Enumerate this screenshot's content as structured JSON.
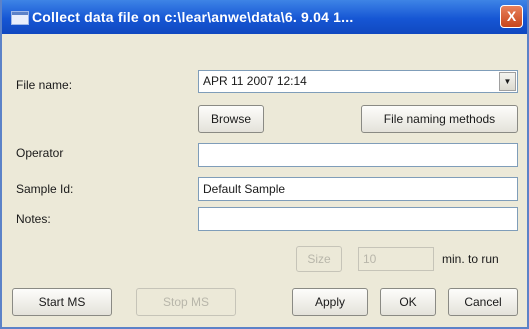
{
  "window": {
    "title": "Collect data file on c:\\lear\\anwe\\data\\6. 9.04 1...",
    "close_label": "X"
  },
  "form": {
    "file_name_label": "File name:",
    "file_name_value": "APR 11 2007 12:14",
    "file_name_arrow": "▼",
    "browse_label": "Browse",
    "naming_methods_label": "File naming methods",
    "operator_label": "Operator",
    "operator_value": "",
    "sample_id_label": "Sample Id:",
    "sample_id_value": "Default Sample",
    "notes_label": "Notes:",
    "notes_value": ""
  },
  "run": {
    "size_label": "Size",
    "minutes_value": "10",
    "minutes_unit": "min. to run"
  },
  "buttons": {
    "start_label": "Start MS",
    "stop_label": "Stop MS",
    "apply_label": "Apply",
    "ok_label": "OK",
    "cancel_label": "Cancel"
  }
}
